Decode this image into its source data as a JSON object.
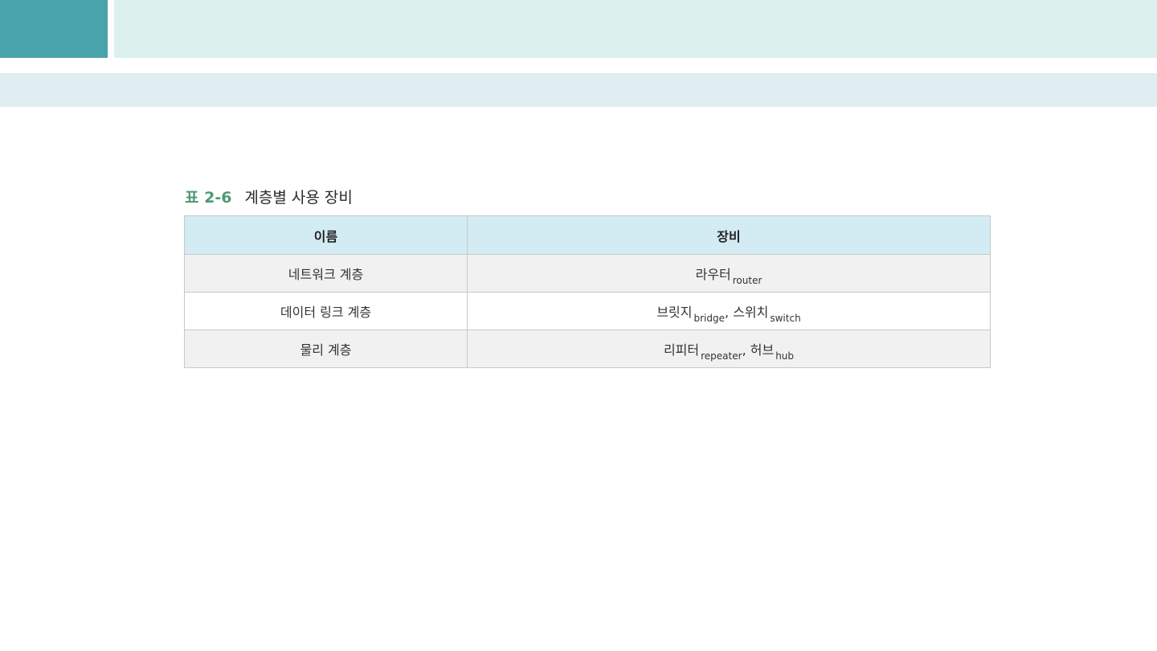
{
  "caption": {
    "label": "표 2-6",
    "title": "계층별 사용 장비"
  },
  "table": {
    "headers": {
      "name": "이름",
      "equipment": "장비"
    },
    "rows": [
      {
        "name": "네트워크 계층",
        "items": [
          {
            "ko": "라우터",
            "en": "router"
          }
        ]
      },
      {
        "name": "데이터 링크 계층",
        "items": [
          {
            "ko": "브릿지",
            "en": "bridge"
          },
          {
            "ko": "스위치",
            "en": "switch"
          }
        ]
      },
      {
        "name": "물리 계층",
        "items": [
          {
            "ko": "리피터",
            "en": "repeater"
          },
          {
            "ko": "허브",
            "en": "hub"
          }
        ]
      }
    ],
    "separator": ","
  },
  "colors": {
    "header_accent": "#48a3ab",
    "header_band": "#dcf0ed",
    "subheader_band": "#e0edf2",
    "table_header_bg": "#d3ecf4",
    "caption_label": "#4e9a72"
  }
}
